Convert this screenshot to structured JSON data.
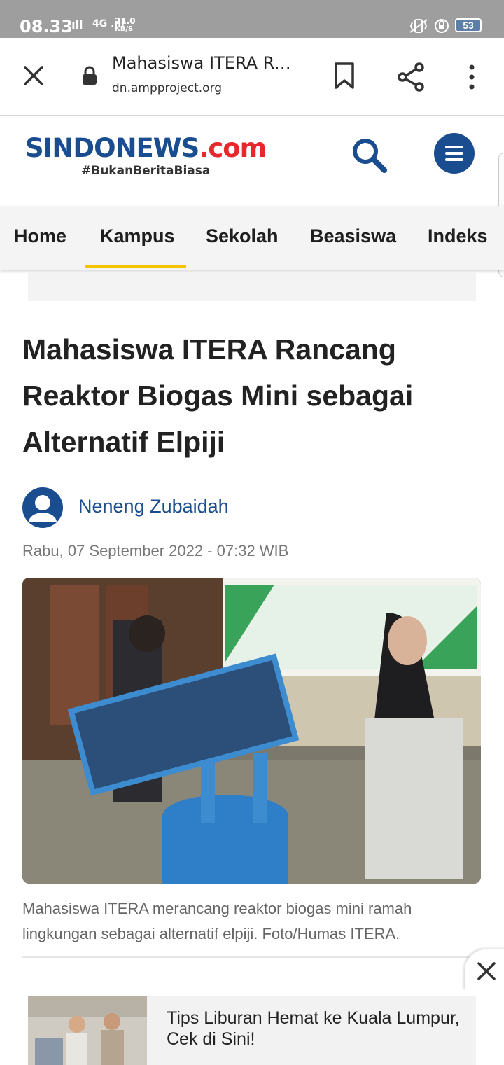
{
  "status": {
    "time": "08.33",
    "signal1": ".ıll",
    "signal2": "4G .ıll",
    "net_speed_value": "21.0",
    "net_speed_unit": "KB/S",
    "battery": "53"
  },
  "browser": {
    "title": "Mahasiswa ITERA Ranc...",
    "url": "dn.ampproject.org"
  },
  "site": {
    "logo_part1": "SIND",
    "logo_part2": "O",
    "logo_part3": "NEWS",
    "logo_part4": ".com",
    "tagline": "#BukanBeritaBiasa"
  },
  "nav": {
    "items": [
      {
        "label": "Home"
      },
      {
        "label": "Kampus"
      },
      {
        "label": "Sekolah"
      },
      {
        "label": "Beasiswa"
      },
      {
        "label": "Indeks"
      }
    ],
    "active": "Kampus"
  },
  "article": {
    "headline": "Mahasiswa ITERA Rancang Reaktor Biogas Mini sebagai Alternatif Elpiji",
    "author": "Neneng Zubaidah",
    "date": "Rabu, 07 September 2022 - 07:32 WIB",
    "caption": "Mahasiswa ITERA merancang reaktor biogas mini ramah lingkungan sebagai alternatif elpiji. Foto/Humas ITERA."
  },
  "ad": {
    "text": "Tips Liburan Hemat ke Kuala Lumpur, Cek di Sini!"
  },
  "colors": {
    "brand_blue": "#1a4d8f",
    "brand_red": "#e8262b",
    "nav_active": "#f5c400",
    "status_bar": "#9e9e9e"
  },
  "icons": [
    "close-icon",
    "lock-icon",
    "bookmark-icon",
    "share-icon",
    "more-vert-icon",
    "search-icon",
    "menu-icon",
    "user-icon",
    "ad-close-icon"
  ]
}
